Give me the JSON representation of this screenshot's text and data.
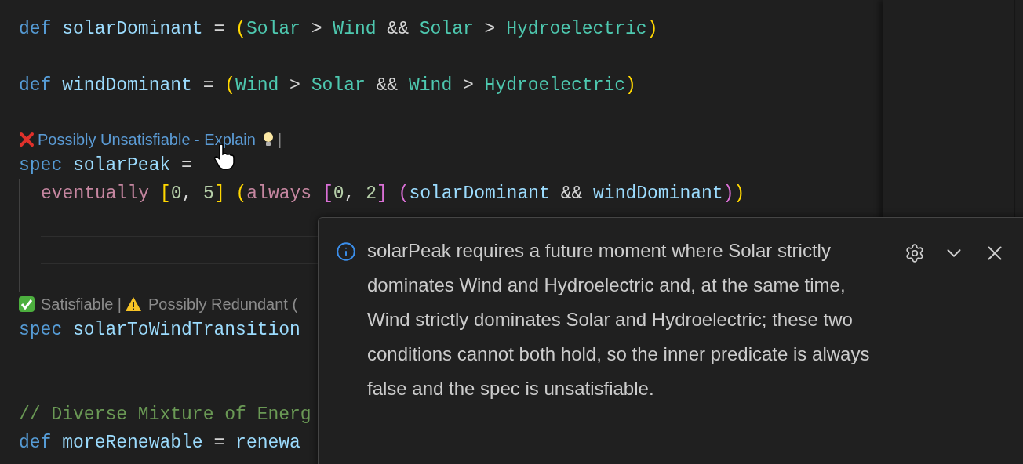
{
  "editor": {
    "lines": [
      {
        "kind": "code",
        "tokens": [
          {
            "t": "def ",
            "kind": "keyword"
          },
          {
            "t": "solarDominant",
            "kind": "name"
          },
          {
            "t": " = ",
            "kind": "op"
          },
          {
            "t": "(",
            "kind": "paren1"
          },
          {
            "t": "Solar",
            "kind": "type"
          },
          {
            "t": " > ",
            "kind": "op"
          },
          {
            "t": "Wind",
            "kind": "type"
          },
          {
            "t": " && ",
            "kind": "op"
          },
          {
            "t": "Solar",
            "kind": "type"
          },
          {
            "t": " > ",
            "kind": "op"
          },
          {
            "t": "Hydroelectric",
            "kind": "type"
          },
          {
            "t": ")",
            "kind": "paren1"
          }
        ]
      },
      {
        "kind": "blank"
      },
      {
        "kind": "code",
        "tokens": [
          {
            "t": "def ",
            "kind": "keyword"
          },
          {
            "t": "windDominant",
            "kind": "name"
          },
          {
            "t": " = ",
            "kind": "op"
          },
          {
            "t": "(",
            "kind": "paren1"
          },
          {
            "t": "Wind",
            "kind": "type"
          },
          {
            "t": " > ",
            "kind": "op"
          },
          {
            "t": "Solar",
            "kind": "type"
          },
          {
            "t": " && ",
            "kind": "op"
          },
          {
            "t": "Wind",
            "kind": "type"
          },
          {
            "t": " > ",
            "kind": "op"
          },
          {
            "t": "Hydroelectric",
            "kind": "type"
          },
          {
            "t": ")",
            "kind": "paren1"
          }
        ]
      },
      {
        "kind": "blank"
      },
      {
        "kind": "lens",
        "parts": [
          {
            "kind": "error-icon"
          },
          {
            "kind": "link",
            "t": "Possibly Unsatisfiable - Explain"
          },
          {
            "kind": "bulb-icon"
          },
          {
            "kind": "text",
            "t": "|"
          }
        ]
      },
      {
        "kind": "code",
        "tokens": [
          {
            "t": "spec ",
            "kind": "keyword"
          },
          {
            "t": "solarPeak",
            "kind": "name"
          },
          {
            "t": " =",
            "kind": "op"
          }
        ],
        "children": [
          {
            "kind": "code",
            "tokens": [
              {
                "t": "eventually ",
                "kind": "temporal"
              },
              {
                "t": "[",
                "kind": "paren1"
              },
              {
                "t": "0",
                "kind": "number"
              },
              {
                "t": ", ",
                "kind": "op"
              },
              {
                "t": "5",
                "kind": "number"
              },
              {
                "t": "] ",
                "kind": "paren1"
              },
              {
                "t": "(",
                "kind": "paren1"
              },
              {
                "t": "always ",
                "kind": "temporal"
              },
              {
                "t": "[",
                "kind": "paren2"
              },
              {
                "t": "0",
                "kind": "number"
              },
              {
                "t": ", ",
                "kind": "op"
              },
              {
                "t": "2",
                "kind": "number"
              },
              {
                "t": "] ",
                "kind": "paren2"
              },
              {
                "t": "(",
                "kind": "paren2"
              },
              {
                "t": "solarDominant",
                "kind": "name"
              },
              {
                "t": " && ",
                "kind": "op"
              },
              {
                "t": "windDominant",
                "kind": "name"
              },
              {
                "t": ")",
                "kind": "paren2"
              },
              {
                "t": ")",
                "kind": "paren1"
              }
            ]
          },
          {
            "kind": "blank"
          },
          {
            "kind": "current-line"
          },
          {
            "kind": "blank"
          }
        ]
      },
      {
        "kind": "lens",
        "parts": [
          {
            "kind": "ok-icon"
          },
          {
            "kind": "text",
            "t": "Satisfiable |"
          },
          {
            "kind": "warning-icon"
          },
          {
            "kind": "text",
            "t": "Possibly Redundant ("
          }
        ]
      },
      {
        "kind": "code",
        "tokens": [
          {
            "t": "spec ",
            "kind": "keyword"
          },
          {
            "t": "solarToWindTransition",
            "kind": "name"
          }
        ]
      },
      {
        "kind": "blank"
      },
      {
        "kind": "blank"
      },
      {
        "kind": "code",
        "tokens": [
          {
            "t": "// Diverse Mixture of Energ",
            "kind": "comment"
          }
        ]
      },
      {
        "kind": "code",
        "tokens": [
          {
            "t": "def ",
            "kind": "keyword"
          },
          {
            "t": "moreRenewable",
            "kind": "name"
          },
          {
            "t": " = ",
            "kind": "op"
          },
          {
            "t": "renewa",
            "kind": "name"
          }
        ]
      }
    ]
  },
  "hover": {
    "message": "solarPeak requires a future moment where Solar strictly dominates Wind and Hydroelectric and, at the same time, Wind strictly dominates Solar and Hydroelectric; these two conditions cannot both hold, so the inner predicate is always false and the spec is unsatisfiable."
  }
}
